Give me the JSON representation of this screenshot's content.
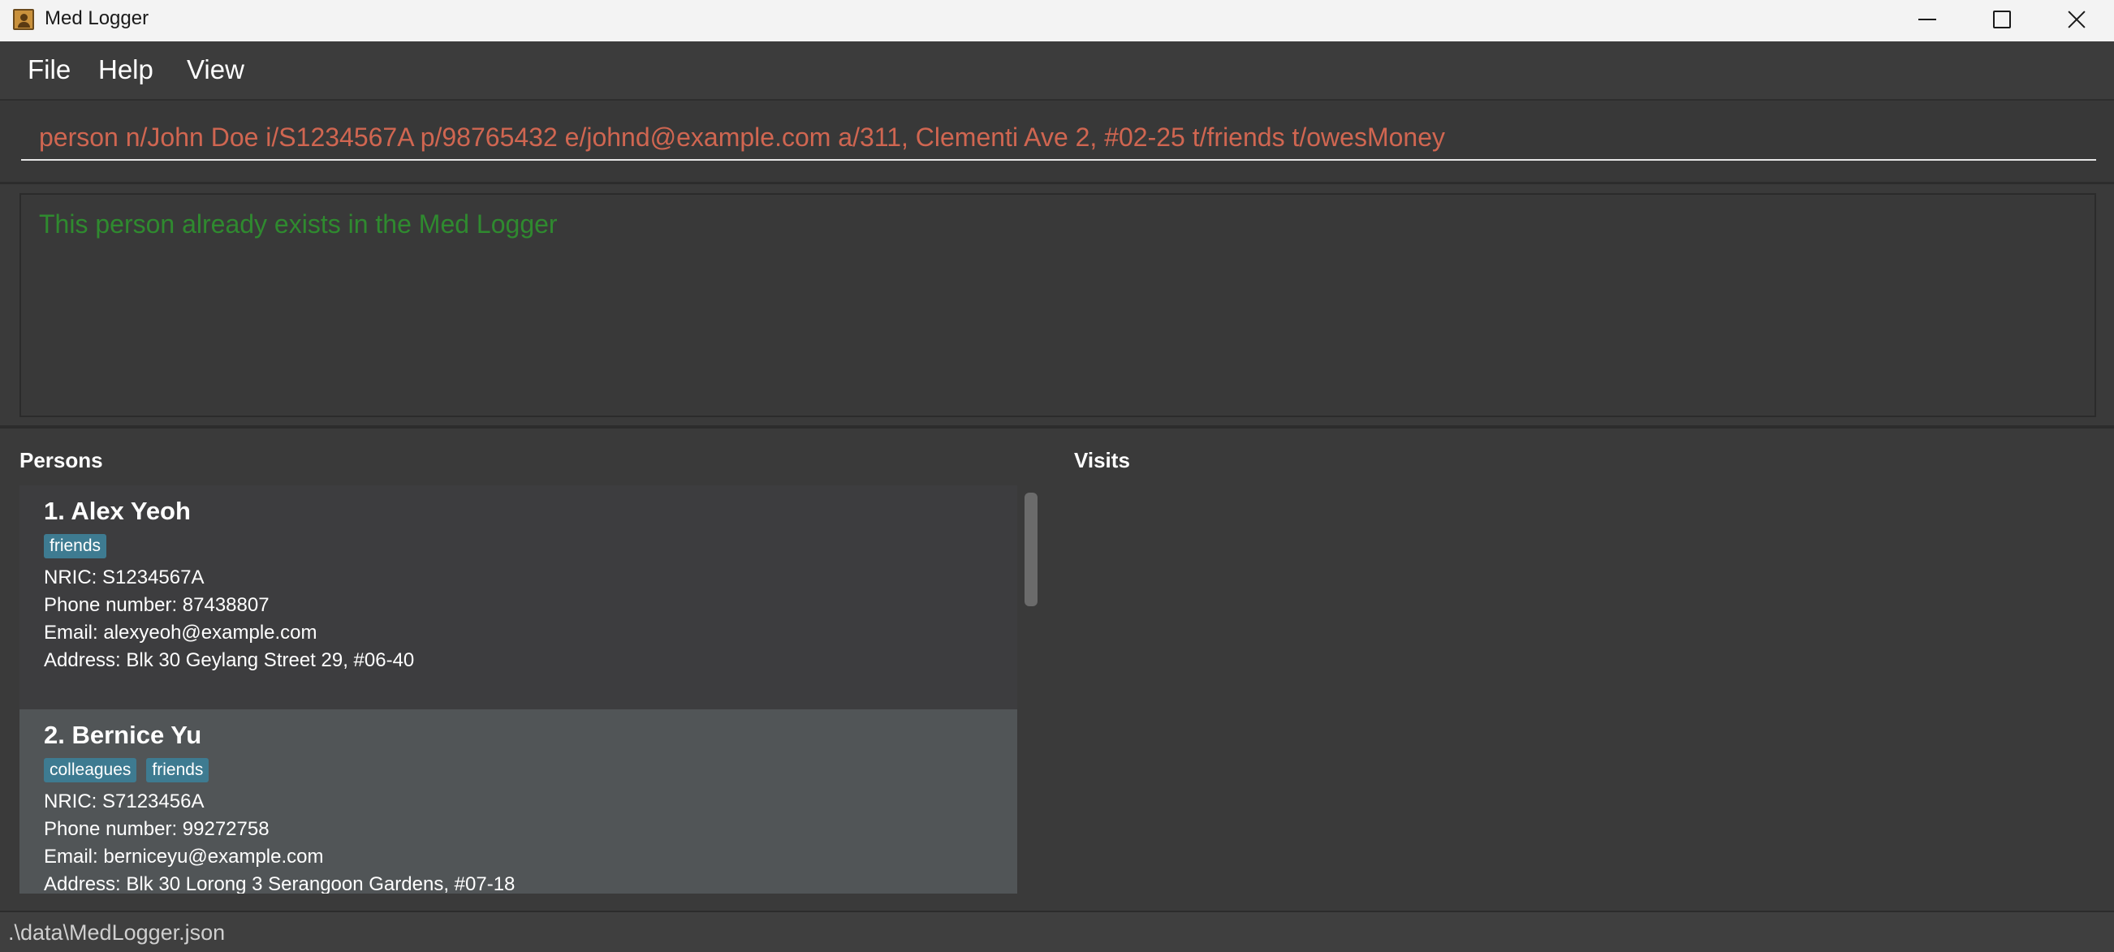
{
  "window": {
    "title": "Med Logger",
    "icon": "app-icon"
  },
  "menu": {
    "file": "File",
    "help": "Help",
    "view": "View"
  },
  "command": {
    "value": "person n/John Doe i/S1234567A p/98765432 e/johnd@example.com a/311, Clementi Ave 2, #02-25 t/friends t/owesMoney"
  },
  "result": {
    "message": "This person already exists in the Med Logger"
  },
  "panels": {
    "persons": "Persons",
    "visits": "Visits"
  },
  "persons": [
    {
      "name": "1. Alex Yeoh",
      "tags": [
        "friends"
      ],
      "nric": "NRIC: S1234567A",
      "phone": "Phone number: 87438807",
      "email": "Email: alexyeoh@example.com",
      "address": "Address: Blk 30 Geylang Street 29, #06-40"
    },
    {
      "name": "2. Bernice Yu",
      "tags": [
        "colleagues",
        "friends"
      ],
      "nric": "NRIC: S7123456A",
      "phone": "Phone number: 99272758",
      "email": "Email: berniceyu@example.com",
      "address": "Address: Blk 30 Lorong 3 Serangoon Gardens, #07-18"
    }
  ],
  "status": {
    "file_path": ".\\data\\MedLogger.json"
  },
  "colors": {
    "command_text": "#d06651",
    "result_text": "#2f8a2f",
    "tag_bg": "#3e7b91",
    "selected_card_bg": "#515557"
  }
}
